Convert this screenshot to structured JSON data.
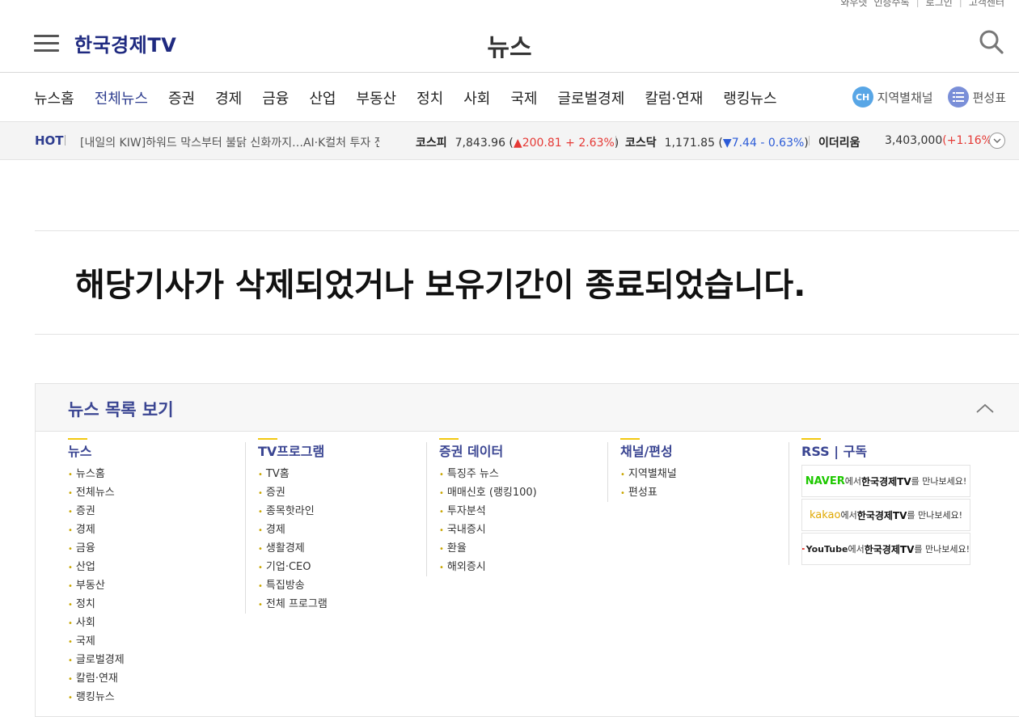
{
  "util": {
    "items": [
      "와우넷",
      "인증수록",
      "로그인",
      "고객센터"
    ]
  },
  "header": {
    "logo": "한국경제TV",
    "section_title": "뉴스"
  },
  "gnb": {
    "items": [
      "뉴스홈",
      "전체뉴스",
      "증권",
      "경제",
      "금융",
      "산업",
      "부동산",
      "정치",
      "사회",
      "국제",
      "글로벌경제",
      "칼럼·연재",
      "랭킹뉴스"
    ],
    "active": "전체뉴스",
    "channel_badge": "CH",
    "channel_label": "지역별채널",
    "schedule_label": "편성표"
  },
  "hot": {
    "label": "HOT",
    "headline": "[내일의 KIW]하워드 막스부터 불닭 신화까지…AI·K컬처 투자 전",
    "kospi": {
      "name": "코스피",
      "value": "7,843.96",
      "change": "200.81",
      "rate": "+ 2.63%"
    },
    "kosdaq": {
      "name": "코스닥",
      "value": "1,171.85",
      "change": "7.44",
      "rate": "- 0.63%"
    },
    "eth": {
      "name": "이더리움",
      "value": "3,403,000",
      "rate": "(+1.16%)"
    }
  },
  "message": "해당기사가 삭제되었거나 보유기간이 종료되었습니다.",
  "newslist": {
    "title": "뉴스 목록 보기",
    "columns": [
      {
        "title": "뉴스",
        "items": [
          "뉴스홈",
          "전체뉴스",
          "증권",
          "경제",
          "금융",
          "산업",
          "부동산",
          "정치",
          "사회",
          "국제",
          "글로벌경제",
          "칼럼·연재",
          "랭킹뉴스"
        ]
      },
      {
        "title": "TV프로그램",
        "items": [
          "TV홈",
          "증권",
          "종목핫라인",
          "경제",
          "생활경제",
          "기업·CEO",
          "특집방송",
          "전체 프로그램"
        ]
      },
      {
        "title": "증권 데이터",
        "items": [
          "특징주 뉴스",
          "매매신호 (랭킹100)",
          "투자분석",
          "국내증시",
          "환율",
          "해외증시"
        ]
      },
      {
        "title": "채널/편성",
        "items": [
          "지역별채널",
          "편성표"
        ]
      }
    ],
    "rss": {
      "title": "RSS | 구독",
      "boxes": [
        {
          "brand": "NAVER",
          "brand_color": "#1ec800",
          "mid": "에서",
          "name": "한국경제TV",
          "tail": "를 만나보세요!"
        },
        {
          "brand": "kakao",
          "brand_color": "#f2b900",
          "mid": "에서",
          "name": "한국경제TV",
          "tail": "를 만나보세요!"
        },
        {
          "brand": "YouTube",
          "brand_color": "#222222",
          "mid": "에서",
          "name": "한국경제TV",
          "tail": "를 만나보세요!"
        }
      ]
    }
  }
}
